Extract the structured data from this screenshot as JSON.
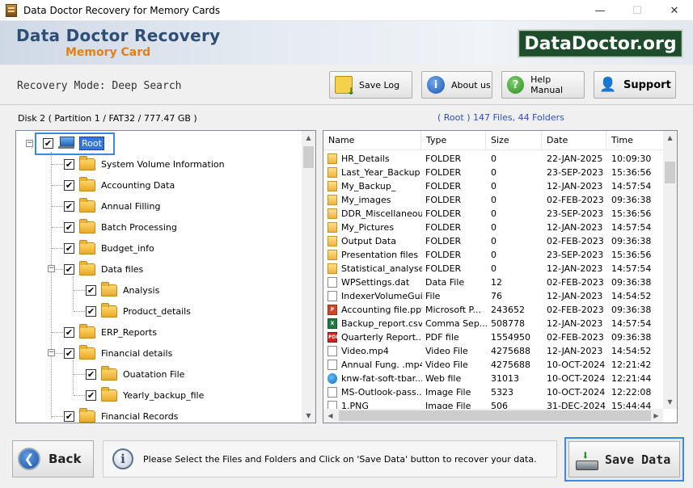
{
  "window": {
    "title": "Data Doctor Recovery for Memory Cards",
    "minimize": "—",
    "maximize": "☐",
    "close": "✕"
  },
  "banner": {
    "brand_line1": "Data Doctor Recovery",
    "brand_line2": "Memory Card",
    "logo": "DataDoctor.org"
  },
  "toolbar": {
    "mode": "Recovery Mode: Deep Search",
    "save_log": "Save Log",
    "about_us": "About us",
    "help_manual": "Help Manual",
    "support": "Support"
  },
  "disk_label": "Disk 2 ( Partition 1 / FAT32 / 777.47 GB )",
  "root_info": "( Root )   147 Files, 44 Folders",
  "tree": {
    "root": "Root",
    "items": [
      {
        "label": "System Volume Information",
        "level": 1
      },
      {
        "label": "Accounting Data",
        "level": 1
      },
      {
        "label": "Annual Filling",
        "level": 1
      },
      {
        "label": "Batch Processing",
        "level": 1
      },
      {
        "label": "Budget_info",
        "level": 1
      },
      {
        "label": "Data files",
        "level": 1,
        "expanded": true
      },
      {
        "label": "Analysis",
        "level": 2
      },
      {
        "label": "Product_details",
        "level": 2
      },
      {
        "label": "ERP_Reports",
        "level": 1
      },
      {
        "label": "Financial details",
        "level": 1,
        "expanded": true
      },
      {
        "label": "Ouatation File",
        "level": 2
      },
      {
        "label": "Yearly_backup_file",
        "level": 2
      },
      {
        "label": "Financial Records",
        "level": 1
      }
    ]
  },
  "list": {
    "headers": {
      "name": "Name",
      "type": "Type",
      "size": "Size",
      "date": "Date",
      "time": "Time"
    },
    "rows": [
      {
        "icon": "folder",
        "name": "HR_Details",
        "type": "FOLDER",
        "size": "0",
        "date": "22-JAN-2025",
        "time": "10:09:30"
      },
      {
        "icon": "folder",
        "name": "Last_Year_Backup",
        "type": "FOLDER",
        "size": "0",
        "date": "23-SEP-2023",
        "time": "15:36:56"
      },
      {
        "icon": "folder",
        "name": "My_Backup_",
        "type": "FOLDER",
        "size": "0",
        "date": "12-JAN-2023",
        "time": "14:57:54"
      },
      {
        "icon": "folder",
        "name": "My_images",
        "type": "FOLDER",
        "size": "0",
        "date": "02-FEB-2023",
        "time": "09:36:38"
      },
      {
        "icon": "folder",
        "name": "DDR_Miscellaneous",
        "type": "FOLDER",
        "size": "0",
        "date": "23-SEP-2023",
        "time": "15:36:56"
      },
      {
        "icon": "folder",
        "name": "My_Pictures",
        "type": "FOLDER",
        "size": "0",
        "date": "12-JAN-2023",
        "time": "14:57:54"
      },
      {
        "icon": "folder",
        "name": "Output Data",
        "type": "FOLDER",
        "size": "0",
        "date": "02-FEB-2023",
        "time": "09:36:38"
      },
      {
        "icon": "folder",
        "name": "Presentation files",
        "type": "FOLDER",
        "size": "0",
        "date": "23-SEP-2023",
        "time": "15:36:56"
      },
      {
        "icon": "folder",
        "name": "Statistical_analyses",
        "type": "FOLDER",
        "size": "0",
        "date": "12-JAN-2023",
        "time": "14:57:54"
      },
      {
        "icon": "file",
        "name": "WPSettings.dat",
        "type": "Data File",
        "size": "12",
        "date": "02-FEB-2023",
        "time": "09:36:38"
      },
      {
        "icon": "file",
        "name": "IndexerVolumeGuid",
        "type": "File",
        "size": "76",
        "date": "12-JAN-2023",
        "time": "14:54:52"
      },
      {
        "icon": "ppt",
        "name": "Accounting file.ppt",
        "type": "Microsoft P...",
        "size": "243652",
        "date": "02-FEB-2023",
        "time": "09:36:38"
      },
      {
        "icon": "csv",
        "name": "Backup_report.csv",
        "type": "Comma Sep...",
        "size": "508778",
        "date": "12-JAN-2023",
        "time": "14:57:54"
      },
      {
        "icon": "pdf",
        "name": "Quarterly Report...",
        "type": "PDF file",
        "size": "1554950",
        "date": "02-FEB-2023",
        "time": "09:36:38"
      },
      {
        "icon": "file",
        "name": "Video.mp4",
        "type": "Video File",
        "size": "4275688",
        "date": "12-JAN-2023",
        "time": "14:54:52"
      },
      {
        "icon": "file",
        "name": "Annual Fung. .mp4",
        "type": "Video File",
        "size": "4275688",
        "date": "10-OCT-2024",
        "time": "12:21:42"
      },
      {
        "icon": "web",
        "name": "knw-fat-soft-tbar...",
        "type": "Web file",
        "size": "31013",
        "date": "10-OCT-2024",
        "time": "12:21:44"
      },
      {
        "icon": "img",
        "name": "MS-Outlook-pass...",
        "type": "Image File",
        "size": "5323",
        "date": "10-OCT-2024",
        "time": "12:22:08"
      },
      {
        "icon": "img",
        "name": "1.PNG",
        "type": "Image File",
        "size": "506",
        "date": "31-DEC-2024",
        "time": "15:44:44"
      }
    ]
  },
  "bottom": {
    "back": "Back",
    "message": "Please Select the Files and Folders and Click on 'Save Data' button to recover your data.",
    "save_data": "Save Data"
  }
}
